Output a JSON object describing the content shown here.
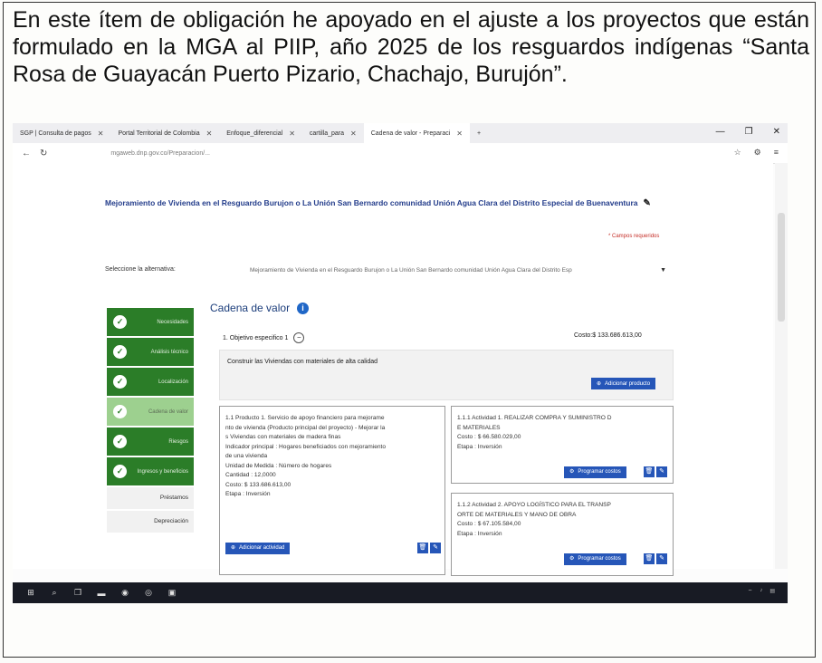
{
  "caption": "En este ítem de obligación he apoyado en el ajuste a los proyectos que están formulado en la MGA al PIIP, año 2025 de los resguardos indígenas “Santa Rosa de Guayacán Puerto Pizario, Chachajo, Burujón”.",
  "browser": {
    "tabs": [
      {
        "label": "SGP | Consulta de pagos"
      },
      {
        "label": "Portal Territorial de Colombia"
      },
      {
        "label": "Enfoque_diferencial"
      },
      {
        "label": "cartilla_para"
      },
      {
        "label": "Cadena de valor - Preparaci"
      }
    ],
    "new_tab": "+",
    "url": "mgaweb.dnp.gov.co/Preparacion/..."
  },
  "page": {
    "title": "Mejoramiento de Vivienda en el Resguardo Burujon o La Unión San Bernardo comunidad Unión Agua Clara del Distrito Especial de Buenaventura",
    "required_note": "* Campos requeridos",
    "alt_label": "Seleccione la alternativa:",
    "alt_value": "Mejoramiento de Vivienda en el Resguardo Burujon o La Unión San Bernardo comunidad Unión Agua Clara del Distrito Esp",
    "steps": [
      {
        "label": "Necesidades"
      },
      {
        "label": "Análisis técnico"
      },
      {
        "label": "Localización"
      },
      {
        "label": "Cadena de valor"
      },
      {
        "label": "Riesgos"
      },
      {
        "label": "Ingresos y beneficios"
      }
    ],
    "side_links": [
      "Préstamos",
      "Depreciación"
    ],
    "cadena_title": "Cadena de valor",
    "objetivo": "1. Objetivo especifico 1",
    "costo_objetivo": "Costo:$ 133.686.613,00",
    "construir": "Construir las Viviendas con materiales de alta calidad",
    "agregar_producto": "Adicionar producto",
    "producto": {
      "lines": [
        "1.1 Producto 1. Servicio de apoyo financiero para mejorame",
        "nto de vivienda (Producto principal del proyecto) - Mejorar la",
        "s Viviendas con materiales de madera finas",
        "Indicador principal : Hogares beneficiados con mejoramiento",
        "de una vivienda",
        "Unidad de Medida : Número de hogares",
        "Cantidad : 12,0000",
        "Costo: $ 133.686.613,00",
        "Etapa : Inversión"
      ],
      "agregar_actividad": "Adicionar actividad"
    },
    "actividad1": {
      "lines": [
        "1.1.1 Actividad 1. REALIZAR COMPRA Y SUMINISTRO D",
        "E MATERIALES",
        "Costo : $ 66.580.029,00",
        "Etapa : Inversión"
      ],
      "programar": "Programar costos"
    },
    "actividad2": {
      "lines": [
        "1.1.2 Actividad 2. APOYO LOGÍSTICO PARA EL TRANSP",
        "ORTE DE MATERIALES Y MANO DE OBRA",
        "Costo : $ 67.105.584,00",
        "Etapa : Inversión"
      ],
      "programar": "Programar costos"
    }
  },
  "colors": {
    "step_green": "#2f7d2c",
    "primary_blue": "#2a58b5",
    "title_blue": "#28408a"
  }
}
